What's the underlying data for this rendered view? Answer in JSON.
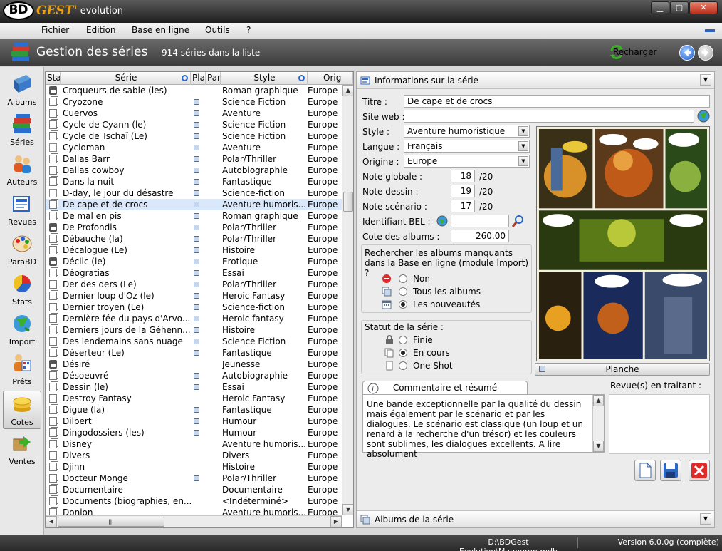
{
  "window": {
    "logo_bd": "BD",
    "logo_gest": "GEST'",
    "logo_evolution": "evolution",
    "min": "▁",
    "max": "▢",
    "close": "✕"
  },
  "menu": [
    "Fichier",
    "Edition",
    "Base en ligne",
    "Outils",
    "?"
  ],
  "header": {
    "title": "Gestion des séries",
    "count": "914 séries dans la liste",
    "reload": "Recharger"
  },
  "sidebar": [
    {
      "label": "Albums",
      "icon": "book-icon"
    },
    {
      "label": "Séries",
      "icon": "books-stack-icon"
    },
    {
      "label": "Auteurs",
      "icon": "authors-icon"
    },
    {
      "label": "Revues",
      "icon": "magazine-icon"
    },
    {
      "label": "ParaBD",
      "icon": "palette-icon"
    },
    {
      "label": "Stats",
      "icon": "pie-chart-icon"
    },
    {
      "label": "Import",
      "icon": "globe-import-icon"
    },
    {
      "label": "Prêts",
      "icon": "loans-icon"
    },
    {
      "label": "Cotes",
      "icon": "coins-icon"
    },
    {
      "label": "Ventes",
      "icon": "sales-icon"
    }
  ],
  "list": {
    "columns": {
      "statut": "Stat",
      "serie": "Série",
      "planche": "Plan",
      "parution": "Par",
      "style": "Style",
      "origine": "Orig"
    },
    "rows": [
      {
        "status": "lock",
        "serie": "Croqueurs de sable (les)",
        "planche": false,
        "style": "Roman graphique",
        "origine": "Europe"
      },
      {
        "status": "copy",
        "serie": "Cryozone",
        "planche": true,
        "style": "Science Fiction",
        "origine": "Europe"
      },
      {
        "status": "copy",
        "serie": "Cuervos",
        "planche": true,
        "style": "Aventure",
        "origine": "Europe"
      },
      {
        "status": "copy",
        "serie": "Cycle de Cyann (le)",
        "planche": true,
        "style": "Science Fiction",
        "origine": "Europe"
      },
      {
        "status": "copy",
        "serie": "Cycle de Tschaï (Le)",
        "planche": true,
        "style": "Science Fiction",
        "origine": "Europe"
      },
      {
        "status": "page",
        "serie": "Cycloman",
        "planche": true,
        "style": "Aventure",
        "origine": "Europe"
      },
      {
        "status": "copy",
        "serie": "Dallas Barr",
        "planche": true,
        "style": "Polar/Thriller",
        "origine": "Europe"
      },
      {
        "status": "copy",
        "serie": "Dallas cowboy",
        "planche": true,
        "style": "Autobiographie",
        "origine": "Europe"
      },
      {
        "status": "copy",
        "serie": "Dans la nuit",
        "planche": true,
        "style": "Fantastique",
        "origine": "Europe"
      },
      {
        "status": "page",
        "serie": "D-day, le jour du désastre",
        "planche": true,
        "style": "Science-fiction",
        "origine": "Europe"
      },
      {
        "status": "copy",
        "serie": "De cape et de crocs",
        "planche": true,
        "style": "Aventure humoris...",
        "origine": "Europe"
      },
      {
        "status": "copy",
        "serie": "De mal en pis",
        "planche": true,
        "style": "Roman graphique",
        "origine": "Europe"
      },
      {
        "status": "lock",
        "serie": "De Profondis",
        "planche": true,
        "style": "Polar/Thriller",
        "origine": "Europe"
      },
      {
        "status": "copy",
        "serie": "Débauche (la)",
        "planche": true,
        "style": "Polar/Thriller",
        "origine": "Europe"
      },
      {
        "status": "copy",
        "serie": "Décalogue (Le)",
        "planche": true,
        "style": "Histoire",
        "origine": "Europe"
      },
      {
        "status": "lock",
        "serie": "Déclic (le)",
        "planche": true,
        "style": "Erotique",
        "origine": "Europe"
      },
      {
        "status": "copy",
        "serie": "Déogratias",
        "planche": true,
        "style": "Essai",
        "origine": "Europe"
      },
      {
        "status": "copy",
        "serie": "Der des ders (Le)",
        "planche": true,
        "style": "Polar/Thriller",
        "origine": "Europe"
      },
      {
        "status": "copy",
        "serie": "Dernier loup d'Oz (le)",
        "planche": true,
        "style": "Heroic Fantasy",
        "origine": "Europe"
      },
      {
        "status": "copy",
        "serie": "Dernier troyen (Le)",
        "planche": true,
        "style": "Science-fiction",
        "origine": "Europe"
      },
      {
        "status": "copy",
        "serie": "Dernière fée du pays d'Arvo...",
        "planche": true,
        "style": "Heroic fantasy",
        "origine": "Europe"
      },
      {
        "status": "copy",
        "serie": "Derniers jours de la Géhenn...",
        "planche": true,
        "style": "Histoire",
        "origine": "Europe"
      },
      {
        "status": "copy",
        "serie": "Des lendemains sans nuage",
        "planche": true,
        "style": "Science Fiction",
        "origine": "Europe"
      },
      {
        "status": "copy",
        "serie": "Déserteur (Le)",
        "planche": true,
        "style": "Fantastique",
        "origine": "Europe"
      },
      {
        "status": "lock",
        "serie": "Désiré",
        "planche": false,
        "style": "Jeunesse",
        "origine": "Europe"
      },
      {
        "status": "copy",
        "serie": "Désoeuvré",
        "planche": true,
        "style": "Autobiographie",
        "origine": "Europe"
      },
      {
        "status": "copy",
        "serie": "Dessin (le)",
        "planche": true,
        "style": "Essai",
        "origine": "Europe"
      },
      {
        "status": "copy",
        "serie": "Destroy Fantasy",
        "planche": false,
        "style": "Heroic Fantasy",
        "origine": "Europe"
      },
      {
        "status": "copy",
        "serie": "Digue (la)",
        "planche": true,
        "style": "Fantastique",
        "origine": "Europe"
      },
      {
        "status": "copy",
        "serie": "Dilbert",
        "planche": true,
        "style": "Humour",
        "origine": "Europe"
      },
      {
        "status": "copy",
        "serie": "Dingodossiers (les)",
        "planche": true,
        "style": "Humour",
        "origine": "Europe"
      },
      {
        "status": "copy",
        "serie": "Disney",
        "planche": false,
        "style": "Aventure humoris...",
        "origine": "Europe"
      },
      {
        "status": "copy",
        "serie": "Divers",
        "planche": false,
        "style": "Divers",
        "origine": "Europe"
      },
      {
        "status": "copy",
        "serie": "Djinn",
        "planche": false,
        "style": "Histoire",
        "origine": "Europe"
      },
      {
        "status": "copy",
        "serie": "Docteur Monge",
        "planche": true,
        "style": "Polar/Thriller",
        "origine": "Europe"
      },
      {
        "status": "copy",
        "serie": "Documentaire",
        "planche": false,
        "style": "Documentaire",
        "origine": "Europe"
      },
      {
        "status": "copy",
        "serie": "Documents (biographies, en...",
        "planche": false,
        "style": "<Indéterminé>",
        "origine": "Europe"
      },
      {
        "status": "copy",
        "serie": "Donjon",
        "planche": false,
        "style": "Aventure humoris...",
        "origine": "Europe"
      }
    ]
  },
  "info": {
    "header": "Informations sur la série",
    "titre_label": "Titre :",
    "titre": "De cape et de crocs",
    "site_label": "Site web :",
    "site": "",
    "style_label": "Style :",
    "style": "Aventure humoristique",
    "langue_label": "Langue :",
    "langue": "Français",
    "origine_label": "Origine :",
    "origine": "Europe",
    "note_globale_label": "Note globale :",
    "note_globale": "18",
    "note_dessin_label": "Note dessin :",
    "note_dessin": "19",
    "note_scenario_label": "Note scénario :",
    "note_scenario": "17",
    "sur20": "/20",
    "bel_label": "Identifiant BEL :",
    "bel": "",
    "cote_label": "Cote des albums :",
    "cote": "260.00",
    "recherche_text": "Rechercher les albums manquants dans la Base en ligne (module Import) ?",
    "recherche_options": [
      "Non",
      "Tous les albums",
      "Les nouveautés"
    ],
    "recherche_selected": 2,
    "statut_label": "Statut de la série :",
    "statut_options": [
      "Finie",
      "En cours",
      "One Shot"
    ],
    "statut_selected": 1,
    "planche_label": "Planche",
    "comment_tab": "Commentaire et résumé",
    "comment": "Une bande exceptionnelle par la qualité du dessin mais également par le scénario et par les dialogues. Le scénario est classique (un loup et un renard à la recherche d'un trésor) et les couleurs sont sublimes, les dialogues excellents. A lire absolument",
    "revues_label": "Revue(s) en traitant :",
    "albums_header": "Albums de la série"
  },
  "status": {
    "path": "D:\\BDGest Evolution\\Magneron.mdb",
    "version": "Version 6.0.0g (complète)"
  },
  "colors": {
    "accent": "#2a66c8",
    "selection": "#d9e9fb",
    "header": "#4a4a4a"
  }
}
